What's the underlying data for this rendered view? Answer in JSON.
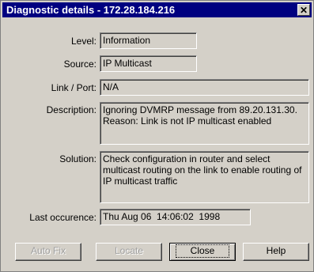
{
  "window": {
    "title": "Diagnostic details - 172.28.184.216",
    "close_glyph": "✕"
  },
  "fields": {
    "level": {
      "label": "Level:",
      "value": "Information"
    },
    "source": {
      "label": "Source:",
      "value": "IP Multicast"
    },
    "link_port": {
      "label": "Link / Port:",
      "value": "N/A"
    },
    "description": {
      "label": "Description:",
      "value": "Ignoring DVMRP message from 89.20.131.30.\nReason: Link is not IP multicast enabled"
    },
    "solution": {
      "label": "Solution:",
      "value": "Check configuration in router and select\nmulticast routing on the link to enable routing of\nIP multicast traffic"
    },
    "last_occurence": {
      "label": "Last occurence:",
      "value": "Thu Aug 06  14:06:02  1998"
    }
  },
  "buttons": {
    "auto_fix": "Auto Fix",
    "locate": "Locate",
    "close": "Close",
    "help": "Help"
  },
  "colors": {
    "titlebar": "#000080",
    "face": "#d4d0c8"
  }
}
